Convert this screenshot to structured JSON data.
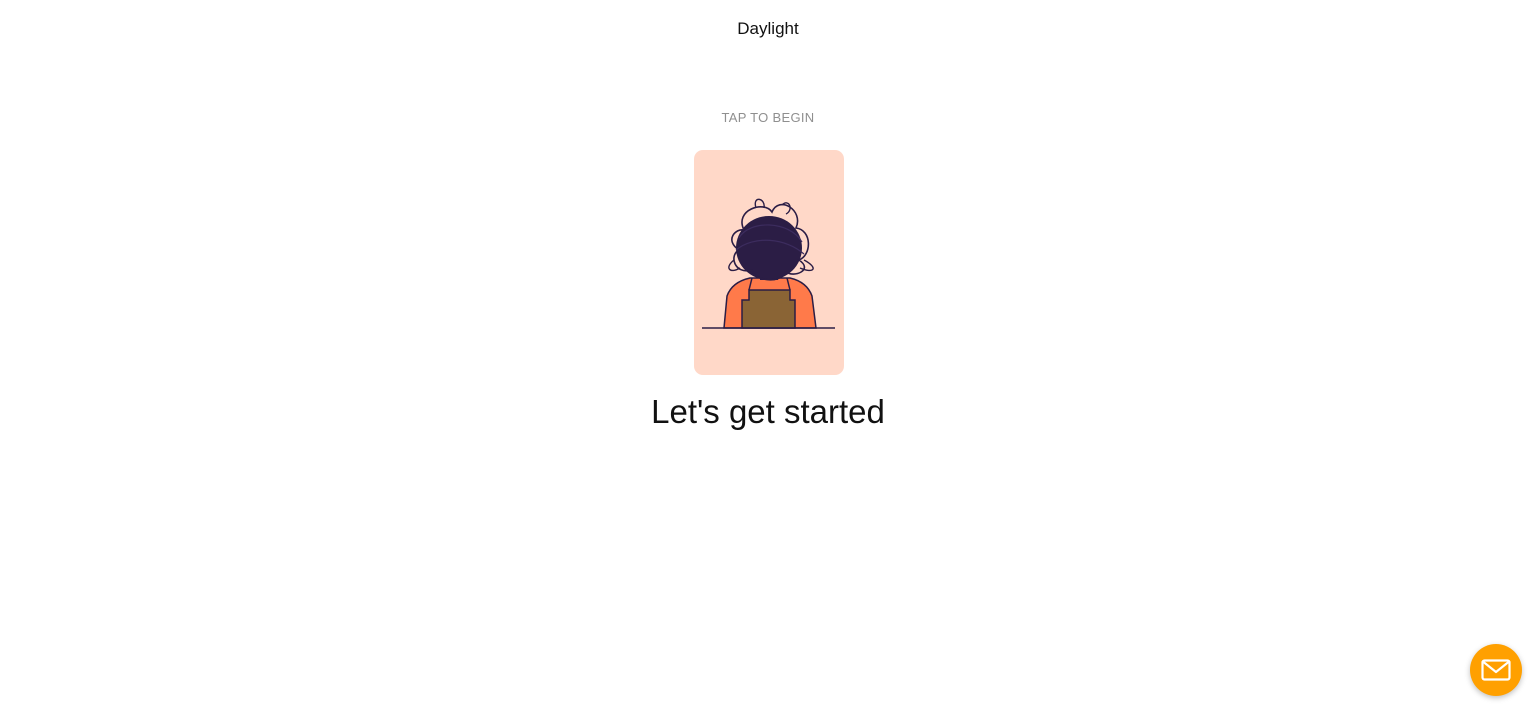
{
  "header": {
    "brand": "Daylight"
  },
  "main": {
    "tap_label": "TAP TO BEGIN",
    "illustration_icon": "person-scribbled-head-illustration",
    "headline": "Let's get started"
  },
  "chat": {
    "icon": "mail-envelope-icon"
  },
  "colors": {
    "card_background": "#ffd8c8",
    "chat_button": "#ffa000",
    "shirt": "#ff7a4a",
    "overalls": "#8a6435",
    "hair": "#2b1d45"
  }
}
